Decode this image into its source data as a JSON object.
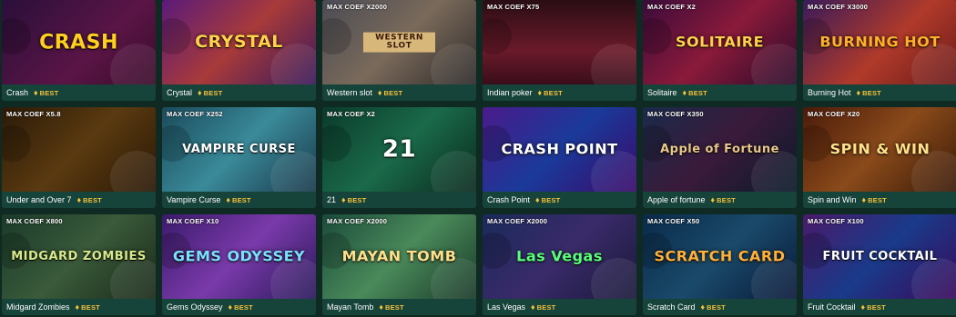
{
  "games": [
    {
      "name": "Crash",
      "badge": "BEST",
      "coef": "",
      "logo": "CRASH",
      "bg": "linear-gradient(135deg,#2a0f3a,#5a1546 60%,#3a0b2a)",
      "logo_color": "#ffcf1f"
    },
    {
      "name": "Crystal",
      "badge": "BEST",
      "coef": "",
      "logo": "CRYSTAL",
      "bg": "linear-gradient(135deg,#5a1a7a,#a83a3a 50%,#3a1a5a)",
      "logo_color": "#ffd24a"
    },
    {
      "name": "Western slot",
      "badge": "BEST",
      "coef": "MAX COEF X2000",
      "logo": "WESTERN SLOT",
      "bg": "linear-gradient(135deg,#4a4b55,#7a6a5a 50%,#2e2a2a)",
      "logo_color": "#3b1a0a"
    },
    {
      "name": "Indian poker",
      "badge": "BEST",
      "coef": "MAX COEF X75",
      "logo": "",
      "bg": "linear-gradient(180deg,#2a0d14,#6a1a2a 60%,#3a0d1a)",
      "logo_color": "#ffffff"
    },
    {
      "name": "Solitaire",
      "badge": "BEST",
      "coef": "MAX COEF X2",
      "logo": "SOLITAIRE",
      "bg": "linear-gradient(135deg,#3a0b3a,#8a1a3a 50%,#2a0b2a)",
      "logo_color": "#ffd04a"
    },
    {
      "name": "Burning Hot",
      "badge": "BEST",
      "coef": "MAX COEF X3000",
      "logo": "BURNING HOT",
      "bg": "linear-gradient(135deg,#3a1a5a,#b03a2a 55%,#6a1a1a)",
      "logo_color": "#ffb02a"
    },
    {
      "name": "Under and Over 7",
      "badge": "BEST",
      "coef": "MAX COEF X5.8",
      "logo": "",
      "bg": "linear-gradient(135deg,#2a1a08,#5a3a10 50%,#2a1806)",
      "logo_color": "#ffffff"
    },
    {
      "name": "Vampire Curse",
      "badge": "BEST",
      "coef": "MAX COEF X252",
      "logo": "VAMPIRE CURSE",
      "bg": "linear-gradient(135deg,#1a4a5a,#3a8a9a 50%,#1a3a4a)",
      "logo_color": "#ffffff"
    },
    {
      "name": "21",
      "badge": "BEST",
      "coef": "MAX COEF X2",
      "logo": "21",
      "bg": "linear-gradient(135deg,#0a3a2a,#1a6a4a 50%,#0a2a1e)",
      "logo_color": "#ffffff"
    },
    {
      "name": "Crash Point",
      "badge": "BEST",
      "coef": "",
      "logo": "CRASH POINT",
      "bg": "linear-gradient(135deg,#4a1a8a,#1a3a9a 50%,#3a0a6a)",
      "logo_color": "#ffffff"
    },
    {
      "name": "Apple of fortune",
      "badge": "BEST",
      "coef": "MAX COEF X350",
      "logo": "Apple of Fortune",
      "bg": "linear-gradient(135deg,#1a2a4a,#3a1a3a 50%,#0a1a2a)",
      "logo_color": "#e8c88a"
    },
    {
      "name": "Spin and Win",
      "badge": "BEST",
      "coef": "MAX COEF X20",
      "logo": "SPIN & WIN",
      "bg": "linear-gradient(135deg,#4a1a0a,#8a4a1a 50%,#3a1a08)",
      "logo_color": "#ffe08a"
    },
    {
      "name": "Midgard Zombies",
      "badge": "BEST",
      "coef": "MAX COEF X800",
      "logo": "MIDGARD ZOMBIES",
      "bg": "linear-gradient(135deg,#1a3a2a,#3a5a3a 50%,#1a2a1a)",
      "logo_color": "#d8e88a"
    },
    {
      "name": "Gems Odyssey",
      "badge": "BEST",
      "coef": "MAX COEF X10",
      "logo": "GEMS ODYSSEY",
      "bg": "linear-gradient(135deg,#3a1a6a,#7a3aaa 50%,#2a1a5a)",
      "logo_color": "#7ae0ff"
    },
    {
      "name": "Mayan Tomb",
      "badge": "BEST",
      "coef": "MAX COEF X2000",
      "logo": "MAYAN TOMB",
      "bg": "linear-gradient(135deg,#1a4a3a,#4a8a5a 50%,#1a3a2a)",
      "logo_color": "#ffe08a"
    },
    {
      "name": "Las Vegas",
      "badge": "BEST",
      "coef": "MAX COEF X2000",
      "logo": "Las Vegas",
      "bg": "linear-gradient(135deg,#1a2a5a,#3a2a6a 50%,#1a1a3a)",
      "logo_color": "#5aff7a"
    },
    {
      "name": "Scratch Card",
      "badge": "BEST",
      "coef": "MAX COEF X50",
      "logo": "SCRATCH CARD",
      "bg": "linear-gradient(135deg,#0a2a4a,#1a4a6a 50%,#0a1a3a)",
      "logo_color": "#ffb03a"
    },
    {
      "name": "Fruit Cocktail",
      "badge": "BEST",
      "coef": "MAX COEF X100",
      "logo": "FRUIT COCKTAIL",
      "bg": "linear-gradient(135deg,#4a1a6a,#1a3a8a 50%,#3a0a5a)",
      "logo_color": "#ffffff"
    }
  ]
}
